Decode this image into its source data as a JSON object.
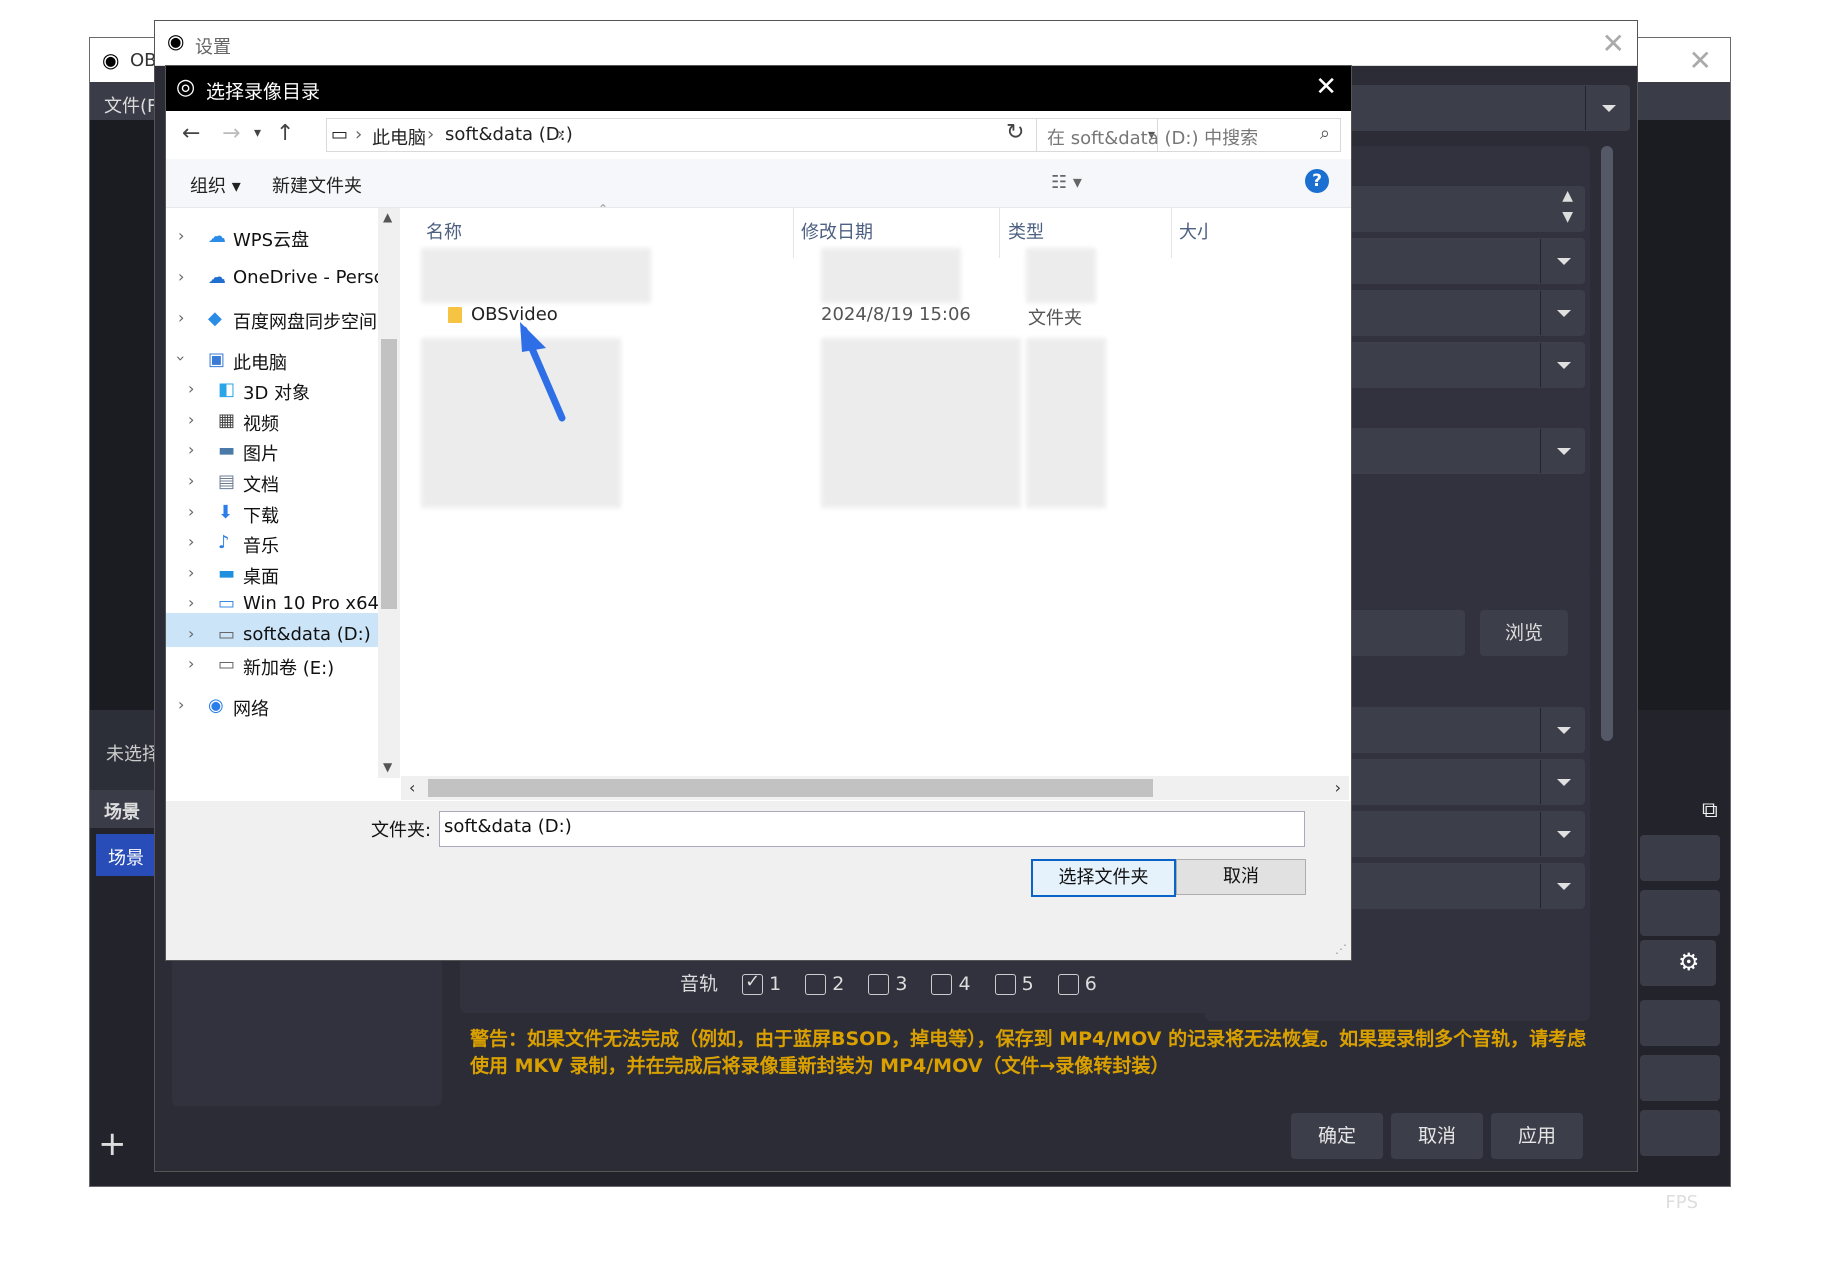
{
  "obs": {
    "title": "OB",
    "menu_label": "文件(F",
    "no_source": "未选择",
    "scenes_header": "场景",
    "scene_item": "场景",
    "add_icon": "+",
    "status_fps": "FPS"
  },
  "settings": {
    "title": "设置",
    "browse": "浏览",
    "tracks_label": "音轨",
    "tracks": [
      "1",
      "2",
      "3",
      "4",
      "5",
      "6"
    ],
    "track_checked": [
      true,
      false,
      false,
      false,
      false,
      false
    ],
    "warning": "警告：如果文件无法完成（例如，由于蓝屏BSOD，掉电等），保存到 MP4/MOV 的记录将无法恢复。如果要录制多个音轨，请考虑使用 MKV 录制，并在完成后将录像重新封装为 MP4/MOV（文件→录像转封装）",
    "ok": "确定",
    "cancel": "取消",
    "apply": "应用"
  },
  "dialog": {
    "title": "选择录像目录",
    "breadcrumbs": [
      "此电脑",
      "soft&data (D:)"
    ],
    "search_placeholder": "在 soft&data (D:) 中搜索",
    "toolbar": {
      "organize": "组织 ▾",
      "new_folder": "新建文件夹",
      "help": "?"
    },
    "nav": [
      {
        "label": "WPS云盘",
        "icon": "cloud-icon"
      },
      {
        "label": "OneDrive - Persc",
        "icon": "onedrive-icon"
      },
      {
        "label": "百度网盘同步空间",
        "icon": "baidu-icon"
      },
      {
        "label": "此电脑",
        "icon": "pc-icon"
      },
      {
        "label": "3D 对象",
        "icon": "cube-icon"
      },
      {
        "label": "视频",
        "icon": "video-icon"
      },
      {
        "label": "图片",
        "icon": "picture-icon"
      },
      {
        "label": "文档",
        "icon": "document-icon"
      },
      {
        "label": "下载",
        "icon": "download-icon"
      },
      {
        "label": "音乐",
        "icon": "music-icon"
      },
      {
        "label": "桌面",
        "icon": "desktop-icon"
      },
      {
        "label": "Win 10 Pro x64",
        "icon": "drive-icon"
      },
      {
        "label": "soft&data (D:)",
        "icon": "drive-icon"
      },
      {
        "label": "新加卷 (E:)",
        "icon": "drive-icon"
      },
      {
        "label": "网络",
        "icon": "network-icon"
      }
    ],
    "columns": [
      "名称",
      "修改日期",
      "类型",
      "大小"
    ],
    "row": {
      "name": "OBSvideo",
      "date": "2024/8/19 15:06",
      "type": "文件夹"
    },
    "folder_label": "文件夹:",
    "folder_value": "soft&data (D:)",
    "select_button": "选择文件夹",
    "cancel_button": "取消"
  }
}
